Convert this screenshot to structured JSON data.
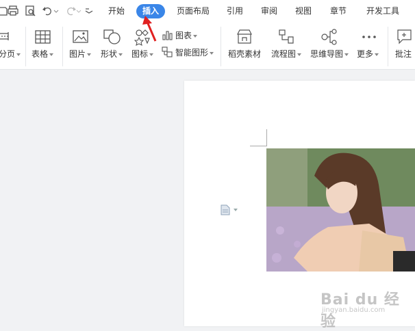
{
  "menu": {
    "tabs": [
      {
        "label": "开始",
        "active": false
      },
      {
        "label": "插入",
        "active": true
      },
      {
        "label": "页面布局",
        "active": false
      },
      {
        "label": "引用",
        "active": false
      },
      {
        "label": "审阅",
        "active": false
      },
      {
        "label": "视图",
        "active": false
      },
      {
        "label": "章节",
        "active": false
      },
      {
        "label": "开发工具",
        "active": false
      }
    ]
  },
  "ribbon": {
    "page_break": "分页",
    "table": "表格",
    "picture": "图片",
    "shape": "形状",
    "icon": "图标",
    "chart": "图表",
    "smart_art": "智能图形",
    "docer_assets": "稻壳素材",
    "flowchart": "流程图",
    "mindmap": "思维导图",
    "more": "更多",
    "comment": "批注"
  },
  "watermark": {
    "main": "Bai du 经验",
    "sub": "jingyan.baidu.com"
  },
  "colors": {
    "accent": "#3a86e8",
    "arrow": "#e02020"
  }
}
